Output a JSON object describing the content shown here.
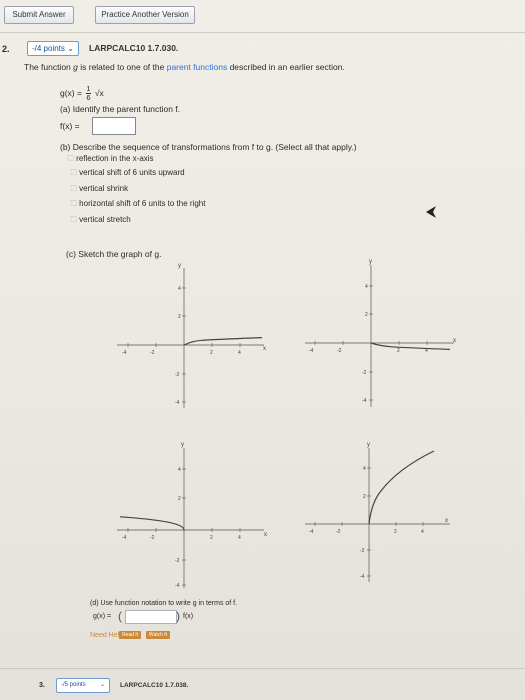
{
  "toolbar": {
    "submit_label": "Submit Answer",
    "practice_label": "Practice Another Version"
  },
  "question2": {
    "points_label": "-/4 points",
    "code": "LARPCALC10 1.7.030.",
    "intro_prefix": "The function ",
    "intro_var": "g",
    "intro_mid": " is related to one of the ",
    "intro_link": "parent functions",
    "intro_suffix": " described in an earlier section.",
    "formula_lhs": "g(x) =",
    "formula_num": "1",
    "formula_den": "6",
    "formula_rad": "√x",
    "part_a_label": "(a) Identify the parent function f.",
    "part_a_lhs": "f(x) =",
    "part_a_value": "",
    "part_b_label": "(b) Describe the sequence of transformations from f to g. (Select all that apply.)",
    "options": [
      "reflection in the x-axis",
      "vertical shift of 6 units upward",
      "vertical shrink",
      "horizontal shift of 6 units to the right",
      "vertical stretch"
    ],
    "part_c_label": "(c) Sketch the graph of g.",
    "part_d_label": "(d) Use function notation to write g in terms of f.",
    "part_d_lhs": "g(x) =",
    "part_d_rhs": "f(x)",
    "need_help": "Need Help?",
    "read_it": "Read It",
    "watch_it": "Watch It"
  },
  "question3": {
    "number": "3.",
    "points_label": "-/5 points",
    "code": "LARPCALC10 1.7.038."
  },
  "graphs": {
    "axis_x": "x",
    "axis_y": "y",
    "ticks": [
      "-4",
      "-2",
      "2",
      "4"
    ]
  }
}
